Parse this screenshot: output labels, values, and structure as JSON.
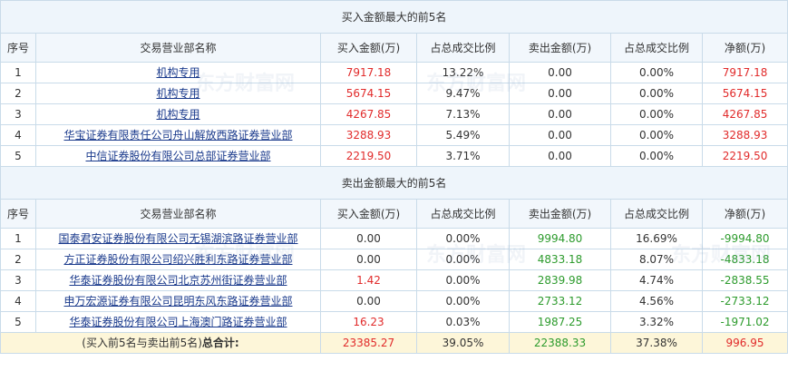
{
  "buy_section": {
    "title": "买入金额最大的前5名",
    "headers": [
      "序号",
      "交易营业部名称",
      "买入金额(万)",
      "占总成交比例",
      "卖出金额(万)",
      "占总成交比例",
      "净额(万)"
    ],
    "rows": [
      {
        "idx": "1",
        "name": "机构专用",
        "buy": "7917.18",
        "buy_pct": "13.22%",
        "sell": "0.00",
        "sell_pct": "0.00%",
        "net": "7917.18"
      },
      {
        "idx": "2",
        "name": "机构专用",
        "buy": "5674.15",
        "buy_pct": "9.47%",
        "sell": "0.00",
        "sell_pct": "0.00%",
        "net": "5674.15"
      },
      {
        "idx": "3",
        "name": "机构专用",
        "buy": "4267.85",
        "buy_pct": "7.13%",
        "sell": "0.00",
        "sell_pct": "0.00%",
        "net": "4267.85"
      },
      {
        "idx": "4",
        "name": "华宝证券有限责任公司舟山解放西路证券营业部",
        "buy": "3288.93",
        "buy_pct": "5.49%",
        "sell": "0.00",
        "sell_pct": "0.00%",
        "net": "3288.93"
      },
      {
        "idx": "5",
        "name": "中信证券股份有限公司总部证券营业部",
        "buy": "2219.50",
        "buy_pct": "3.71%",
        "sell": "0.00",
        "sell_pct": "0.00%",
        "net": "2219.50"
      }
    ]
  },
  "sell_section": {
    "title": "卖出金额最大的前5名",
    "headers": [
      "序号",
      "交易营业部名称",
      "买入金额(万)",
      "占总成交比例",
      "卖出金额(万)",
      "占总成交比例",
      "净额(万)"
    ],
    "rows": [
      {
        "idx": "1",
        "name": "国泰君安证券股份有限公司无锡湖滨路证券营业部",
        "buy": "0.00",
        "buy_pct": "0.00%",
        "sell": "9994.80",
        "sell_pct": "16.69%",
        "net": "-9994.80"
      },
      {
        "idx": "2",
        "name": "方正证券股份有限公司绍兴胜利东路证券营业部",
        "buy": "0.00",
        "buy_pct": "0.00%",
        "sell": "4833.18",
        "sell_pct": "8.07%",
        "net": "-4833.18"
      },
      {
        "idx": "3",
        "name": "华泰证券股份有限公司北京苏州街证券营业部",
        "buy": "1.42",
        "buy_pct": "0.00%",
        "sell": "2839.98",
        "sell_pct": "4.74%",
        "net": "-2838.55"
      },
      {
        "idx": "4",
        "name": "申万宏源证券有限公司昆明东风东路证券营业部",
        "buy": "0.00",
        "buy_pct": "0.00%",
        "sell": "2733.12",
        "sell_pct": "4.56%",
        "net": "-2733.12"
      },
      {
        "idx": "5",
        "name": "华泰证券股份有限公司上海澳门路证券营业部",
        "buy": "16.23",
        "buy_pct": "0.03%",
        "sell": "1987.25",
        "sell_pct": "3.32%",
        "net": "-1971.02"
      }
    ]
  },
  "total": {
    "label_prefix": "(买入前5名与卖出前5名)",
    "label_bold": "总合计:",
    "buy": "23385.27",
    "buy_pct": "39.05%",
    "sell": "22388.33",
    "sell_pct": "37.38%",
    "net": "996.95"
  },
  "watermark": "东方财富网",
  "colors": {
    "positive": "#e12b2b",
    "negative": "#2d9b2d",
    "link": "#1a3a8c",
    "header_bg": "#eef5fb",
    "border": "#c9dbe9",
    "total_bg": "#fdf6d9"
  }
}
